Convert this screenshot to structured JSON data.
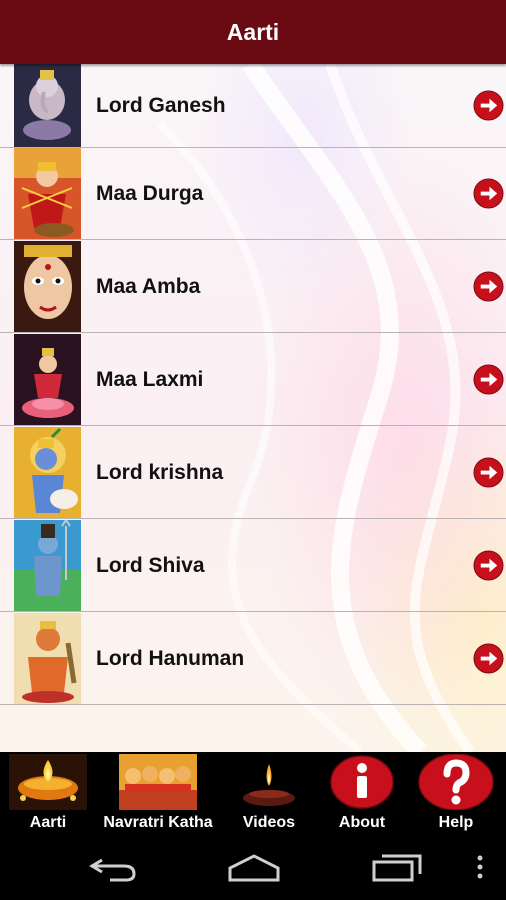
{
  "app_bar": {
    "title": "Aarti"
  },
  "list": {
    "items": [
      {
        "label": "Lord Ganesh",
        "icon": "arrow-right-icon"
      },
      {
        "label": "Maa Durga",
        "icon": "arrow-right-icon"
      },
      {
        "label": "Maa Amba",
        "icon": "arrow-right-icon"
      },
      {
        "label": "Maa Laxmi",
        "icon": "arrow-right-icon"
      },
      {
        "label": "Lord krishna",
        "icon": "arrow-right-icon"
      },
      {
        "label": "Lord Shiva",
        "icon": "arrow-right-icon"
      },
      {
        "label": "Lord Hanuman",
        "icon": "arrow-right-icon"
      }
    ]
  },
  "bottom_nav": {
    "items": [
      {
        "label": "Aarti",
        "icon": "diya-icon"
      },
      {
        "label": "Navratri Katha",
        "icon": "katha-icon"
      },
      {
        "label": "Videos",
        "icon": "lamp-icon"
      },
      {
        "label": "About",
        "icon": "info-icon"
      },
      {
        "label": "Help",
        "icon": "help-icon"
      }
    ]
  },
  "system_nav": {
    "buttons": [
      "back-icon",
      "home-icon",
      "recents-icon",
      "overflow-icon"
    ]
  },
  "colors": {
    "title_bar": "#6a0a12",
    "arrow": "#c8101c",
    "nav_bg": "#000000"
  }
}
